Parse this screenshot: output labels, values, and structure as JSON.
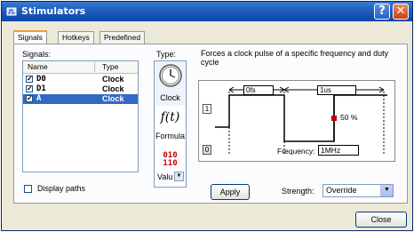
{
  "window": {
    "title": "Stimulators",
    "help_glyph": "?",
    "close_glyph": "✕"
  },
  "tabs": [
    "Signals",
    "Hotkeys",
    "Predefined"
  ],
  "signals": {
    "label": "Signals:",
    "columns": [
      "Name",
      "Type"
    ],
    "rows": [
      {
        "checked": true,
        "name": "D0",
        "type": "Clock",
        "selected": false
      },
      {
        "checked": true,
        "name": "D1",
        "type": "Clock",
        "selected": false
      },
      {
        "checked": true,
        "name": "A",
        "type": "Clock",
        "selected": true
      }
    ],
    "check_glyph": "✓",
    "display_paths_label": "Display paths",
    "display_paths_checked": false
  },
  "type_panel": {
    "label": "Type:",
    "items": [
      {
        "icon": "clock-icon",
        "label": "Clock",
        "selected": true
      },
      {
        "icon": "formula-icon",
        "label": "Formula",
        "glyph": "f(t)"
      },
      {
        "icon": "binary-value-icon",
        "label": "Valu",
        "glyph_lines": [
          "010",
          "110"
        ]
      }
    ]
  },
  "description": "Forces a clock pulse of a specific frequency and duty cycle",
  "diagram": {
    "high_level": "1",
    "low_level": "0",
    "offset_value": "0fs",
    "period_value": "1us",
    "duty_cycle": "50 %",
    "frequency_label": "Frequency:",
    "frequency_value": "1MHz"
  },
  "apply_label": "Apply",
  "strength": {
    "label": "Strength:",
    "value": "Override"
  },
  "close_label": "Close",
  "colors": {
    "selection": "#316ac5",
    "title_bar": "#0b45a8",
    "duty_marker": "#c00000"
  }
}
